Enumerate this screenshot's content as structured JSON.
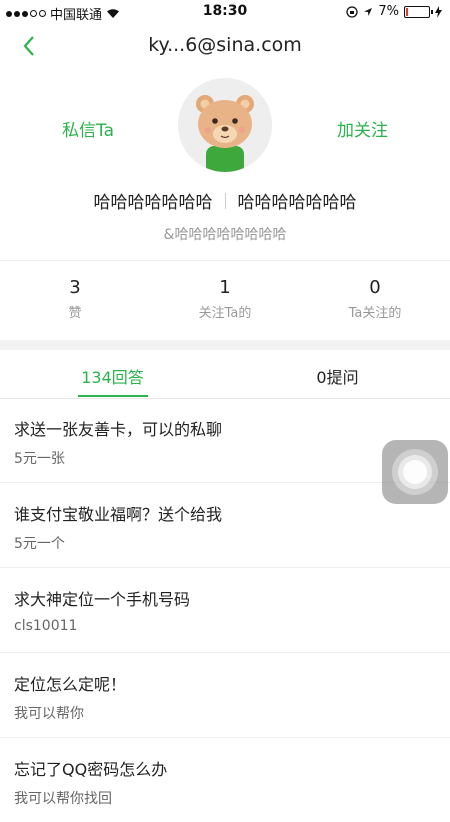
{
  "status": {
    "carrier": "中国联通",
    "time": "18:30",
    "battery": "7%"
  },
  "nav": {
    "title": "ky...6@sina.com"
  },
  "profile": {
    "message_label": "私信Ta",
    "follow_label": "加关注",
    "name_left": "哈哈哈哈哈哈哈",
    "name_right": "哈哈哈哈哈哈哈",
    "handle": "&哈哈哈哈哈哈哈哈"
  },
  "stats": [
    {
      "num": "3",
      "label": "赞"
    },
    {
      "num": "1",
      "label": "关注Ta的"
    },
    {
      "num": "0",
      "label": "Ta关注的"
    }
  ],
  "tabs": [
    {
      "label": "134回答"
    },
    {
      "label": "0提问"
    }
  ],
  "items": [
    {
      "q": "求送一张友善卡，可以的私聊",
      "a": "5元一张"
    },
    {
      "q": "谁支付宝敬业福啊？送个给我",
      "a": "5元一个"
    },
    {
      "q": "求大神定位一个手机号码",
      "a": "cls10011"
    },
    {
      "q": "定位怎么定呢！",
      "a": "我可以帮你"
    },
    {
      "q": "忘记了QQ密码怎么办",
      "a": "我可以帮你找回"
    }
  ],
  "colors": {
    "accent": "#2bb24c"
  }
}
